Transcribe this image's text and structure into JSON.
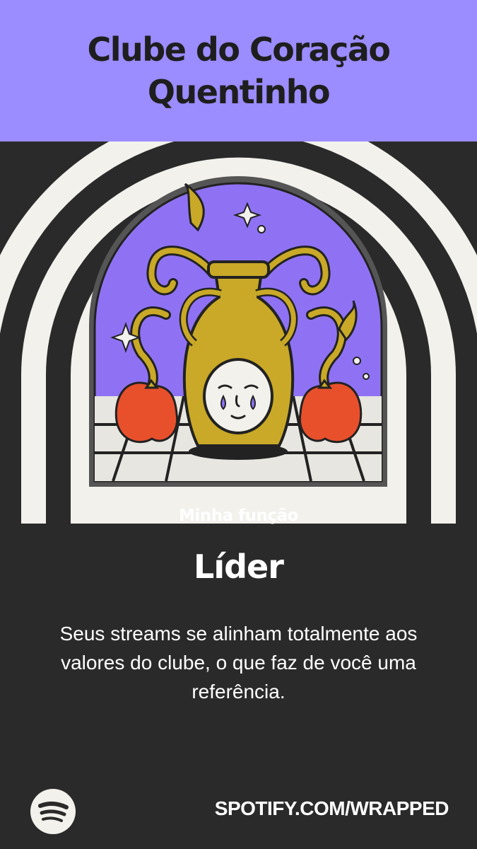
{
  "header": {
    "title_line1": "Clube do Coração",
    "title_line2": "Quentinho"
  },
  "content": {
    "role_heading": "Minha função",
    "role_value": "Líder",
    "description_line1": "Seus streams se alinham totalmente aos",
    "description_line2": "valores do clube, o que faz de você uma",
    "description_line3": "referência."
  },
  "footer": {
    "logo_icon": "spotify-logo-icon",
    "url": "SPOTIFY.COM/WRAPPED"
  },
  "colors": {
    "header_bg": "#9b8cff",
    "page_bg": "#2a2a2a",
    "stripe_light": "#f2f1ec",
    "pin_purple": "#8f72f4",
    "vase_yellow": "#c9a927",
    "flower_red": "#e8502c"
  }
}
